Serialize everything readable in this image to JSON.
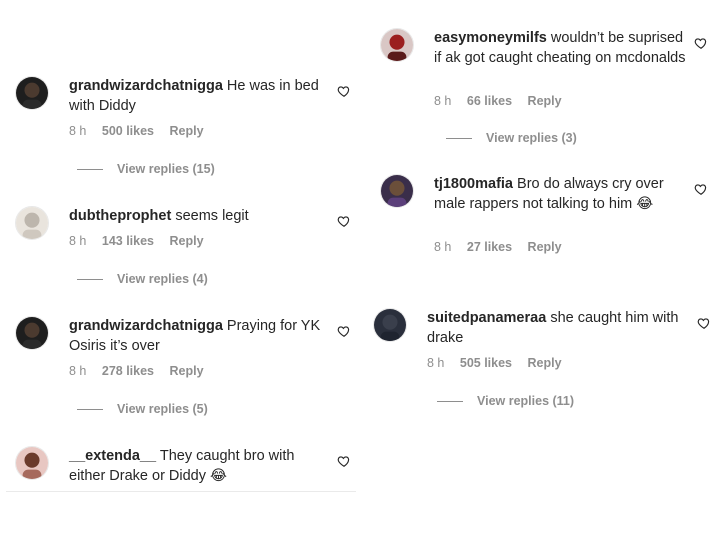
{
  "left": [
    {
      "username": "grandwizardchatnigga",
      "text": "He was in bed with Diddy",
      "time": "8 h",
      "likes": "500 likes",
      "reply": "Reply",
      "view_replies": "View replies (15)",
      "avatar": "dark-portrait"
    },
    {
      "username": "dubtheprophet",
      "text": "seems legit",
      "time": "8 h",
      "likes": "143 likes",
      "reply": "Reply",
      "view_replies": "View replies (4)",
      "avatar": "light-portrait"
    },
    {
      "username": "grandwizardchatnigga",
      "text": "Praying for YK Osiris it’s over",
      "time": "8 h",
      "likes": "278 likes",
      "reply": "Reply",
      "view_replies": "View replies (5)",
      "avatar": "dark-portrait"
    },
    {
      "username": "__extenda__",
      "text": "They caught bro with either Drake or Diddy 😂",
      "avatar": "pink-portrait"
    }
  ],
  "right": [
    {
      "username": "easymoneymilfs",
      "text": "wouldn’t be suprised if ak got caught cheating on mcdonalds",
      "time": "8 h",
      "likes": "66 likes",
      "reply": "Reply",
      "view_replies": "View replies (3)",
      "avatar": "red-portrait"
    },
    {
      "username": "tj1800mafia",
      "text": "Bro do always cry over male rappers not talking to him 😂",
      "time": "8 h",
      "likes": "27 likes",
      "reply": "Reply",
      "avatar": "purple-portrait"
    },
    {
      "username": "suitedpanameraa",
      "text": "she caught him with drake",
      "time": "8 h",
      "likes": "505 likes",
      "reply": "Reply",
      "view_replies": "View replies (11)",
      "avatar": "navy-portrait"
    }
  ],
  "icons": {
    "like": "heart-outline-icon"
  },
  "colors": {
    "text": "#262626",
    "muted": "#8e8e8e"
  }
}
